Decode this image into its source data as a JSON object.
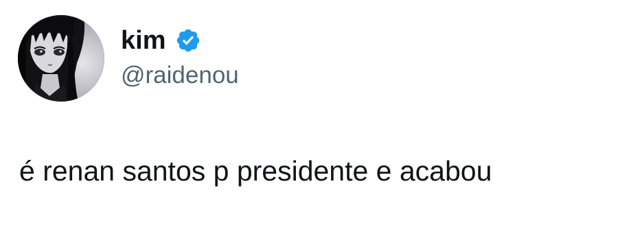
{
  "tweet": {
    "author": {
      "display_name": "kim",
      "handle": "@raidenou",
      "verified": true,
      "avatar_icon": "anime-avatar"
    },
    "text": "é renan santos p presidente e acabou"
  },
  "colors": {
    "text": "#0f1419",
    "secondary_text": "#536471",
    "verified_badge": "#1d9bf0",
    "background": "#ffffff"
  }
}
